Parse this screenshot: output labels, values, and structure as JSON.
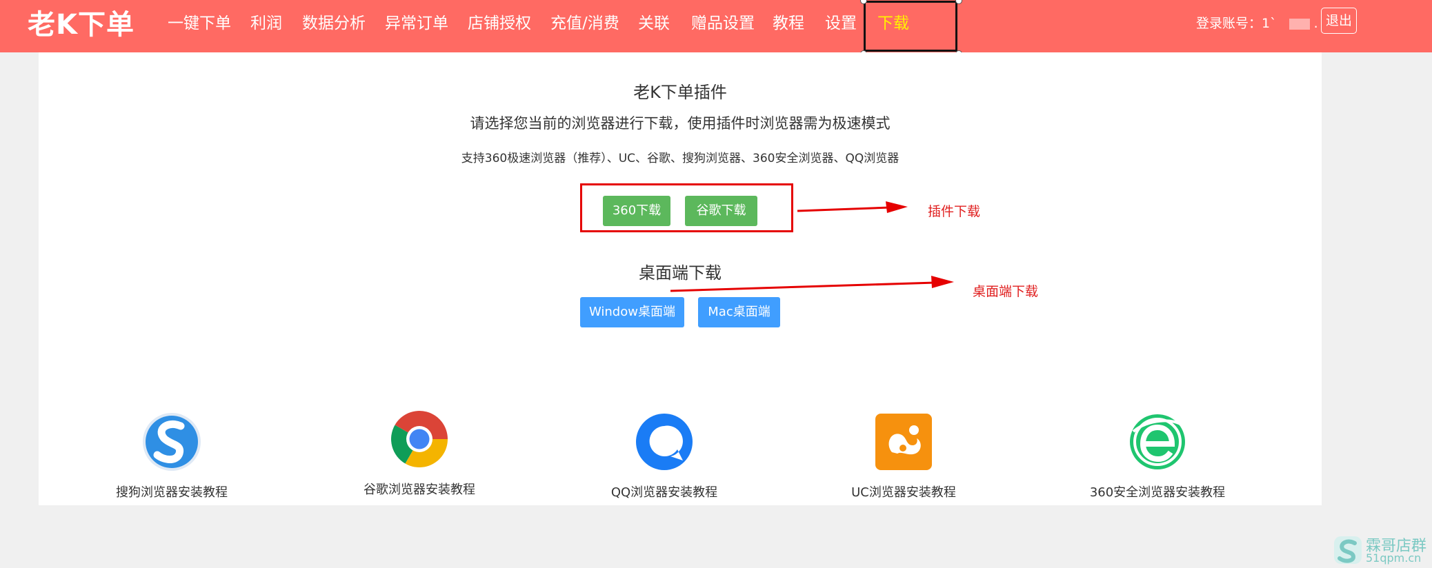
{
  "header": {
    "logo": "老K下单",
    "nav": [
      {
        "label": "一键下单"
      },
      {
        "label": "利润"
      },
      {
        "label": "数据分析"
      },
      {
        "label": "异常订单"
      },
      {
        "label": "店铺授权"
      },
      {
        "label": "充值/消费"
      },
      {
        "label": "关联"
      },
      {
        "label": "赠品设置"
      },
      {
        "label": "教程"
      },
      {
        "label": "设置"
      },
      {
        "label": "下载",
        "active": true
      }
    ],
    "account_label": "登录账号：1`",
    "account_suffix": ".",
    "logout_label": "退出"
  },
  "plugin": {
    "title": "老K下单插件",
    "subtitle": "请选择您当前的浏览器进行下载，使用插件时浏览器需为极速模式",
    "support": "支持360极速浏览器（推荐）、UC、谷歌、搜狗浏览器、360安全浏览器、QQ浏览器",
    "btn_360": "360下载",
    "btn_chrome": "谷歌下载",
    "annotation": "插件下载"
  },
  "desktop": {
    "title": "桌面端下载",
    "btn_windows": "Window桌面端",
    "btn_mac": "Mac桌面端",
    "annotation": "桌面端下载"
  },
  "browsers": [
    {
      "label": "搜狗浏览器安装教程",
      "icon": "sogou-browser-icon"
    },
    {
      "label": "谷歌浏览器安装教程",
      "icon": "chrome-browser-icon"
    },
    {
      "label": "QQ浏览器安装教程",
      "icon": "qq-browser-icon"
    },
    {
      "label": "UC浏览器安装教程",
      "icon": "uc-browser-icon"
    },
    {
      "label": "360安全浏览器安装教程",
      "icon": "360-safe-browser-icon"
    }
  ],
  "watermark": {
    "line1": "霖哥店群",
    "line2": "51qpm.cn"
  },
  "colors": {
    "header_bg": "#ff6a63",
    "active_nav": "#fff200",
    "green_button": "#5cb85c",
    "blue_button": "#409eff",
    "annotation_red": "#e02020"
  }
}
